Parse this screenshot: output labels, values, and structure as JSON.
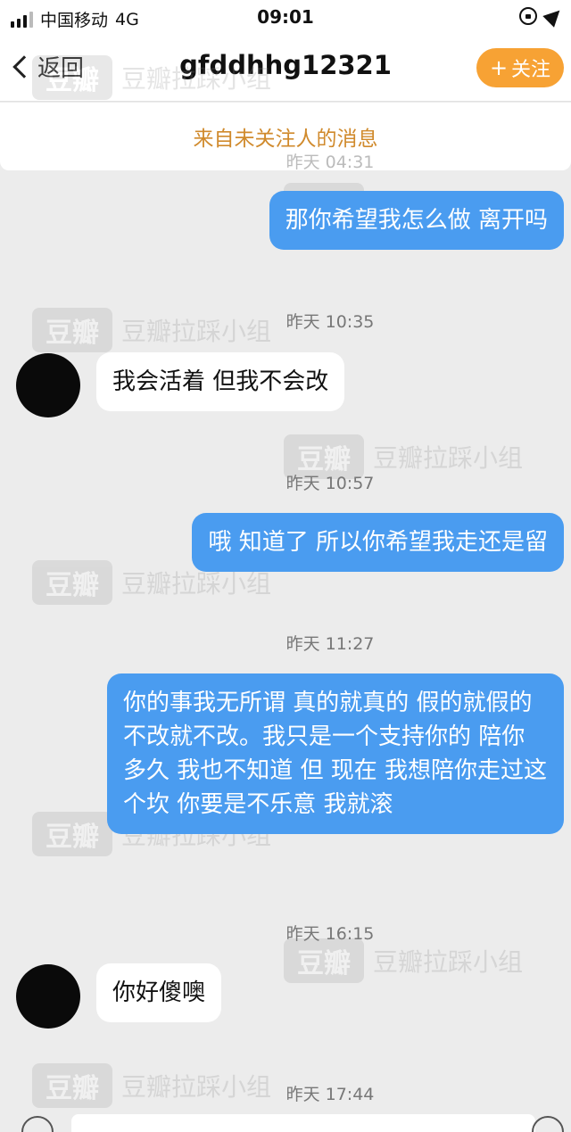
{
  "status_bar": {
    "carrier": "中国移动",
    "network": "4G",
    "time": "09:01"
  },
  "nav": {
    "back_label": "返回",
    "title": "gfddhhg12321",
    "follow_label": "关注",
    "follow_icon": "plus-icon"
  },
  "notice": "来自未关注人的消息",
  "watermark": {
    "logo": "豆瓣",
    "text": "豆瓣拉踩小组"
  },
  "messages": [
    {
      "type": "timestamp",
      "text": "昨天 04:31"
    },
    {
      "type": "outgoing",
      "text": "那你希望我怎么做 离开吗"
    },
    {
      "type": "timestamp",
      "text": "昨天 10:35"
    },
    {
      "type": "incoming",
      "text": "我会活着 但我不会改"
    },
    {
      "type": "timestamp",
      "text": "昨天 10:57"
    },
    {
      "type": "outgoing",
      "text": "哦 知道了 所以你希望我走还是留"
    },
    {
      "type": "timestamp",
      "text": "昨天 11:27"
    },
    {
      "type": "outgoing",
      "text": "你的事我无所谓 真的就真的 假的就假的 不改就不改。我只是一个支持你的 陪你多久 我也不知道 但 现在 我想陪你走过这个坎 你要是不乐意 我就滚"
    },
    {
      "type": "timestamp",
      "text": "昨天 16:15"
    },
    {
      "type": "incoming",
      "text": "你好傻噢"
    },
    {
      "type": "timestamp",
      "text": "昨天 17:44"
    }
  ],
  "colors": {
    "accent": "#f7a234",
    "outgoing_bubble": "#4a9cf0",
    "notice_text": "#d08a2c",
    "background": "#ececec"
  }
}
